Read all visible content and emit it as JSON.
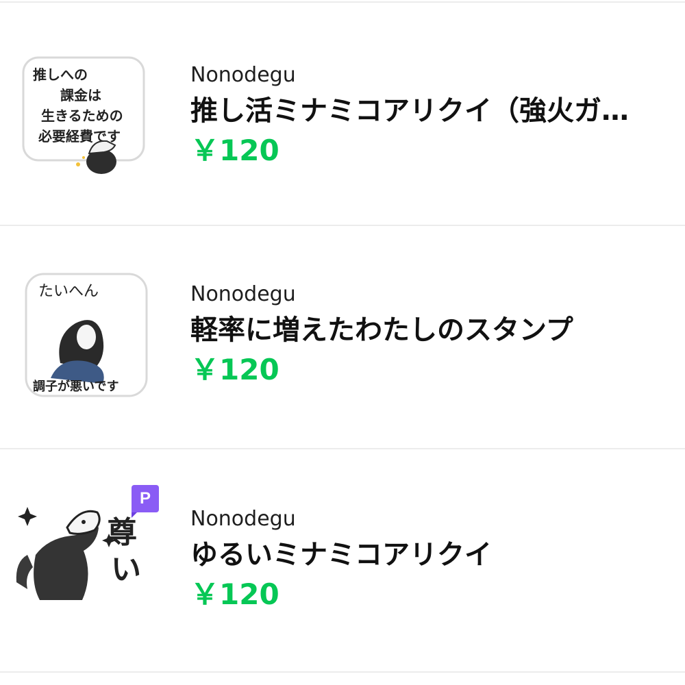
{
  "items": [
    {
      "author": "Nonodegu",
      "title": "推し活ミナミコアリクイ（強火ガ…",
      "price": "￥120",
      "sticker_icon": "sticker-oshi-katsu",
      "sticker_text": "推しへの課金は生きるための必要経費です"
    },
    {
      "author": "Nonodegu",
      "title": "軽率に増えたわたしのスタンプ",
      "price": "￥120",
      "sticker_icon": "sticker-taihen",
      "sticker_text": "たいへん 調子が悪いです"
    },
    {
      "author": "Nonodegu",
      "title": "ゆるいミナミコアリクイ",
      "price": "￥120",
      "sticker_icon": "sticker-toutoi",
      "sticker_text": "尊い",
      "badge": "P"
    }
  ],
  "colors": {
    "price": "#06c755",
    "badge": "#8a5cf5",
    "divider": "#ececec"
  }
}
